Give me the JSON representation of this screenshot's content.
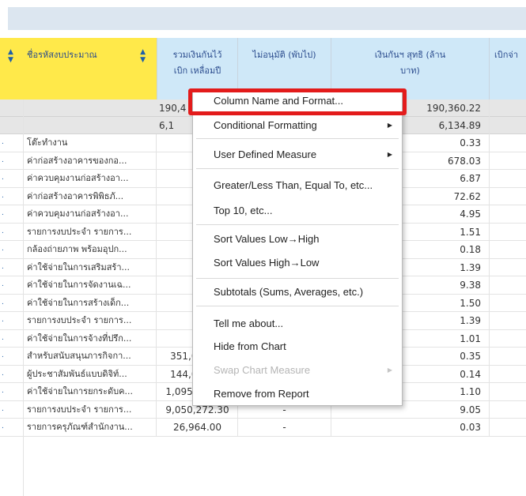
{
  "header": {
    "col_name": "ชื่อรหัสงบประมาณ",
    "col_a": "รวมเงินกันไว้เบิก เหลื่อมปี",
    "col_b": "ไม่อนุมัติ (พับไป)",
    "col_c": "เงินกันฯ สุทธิ (ล้าน บาท)",
    "col_d": "เบิกจ่า"
  },
  "totals": [
    {
      "a": "190,4",
      "c": "190,360.22"
    },
    {
      "a": "6,1",
      "c": "6,134.89"
    }
  ],
  "rows": [
    {
      "name": "โต๊ะทำงาน",
      "a": "",
      "b": "",
      "c": "0.33"
    },
    {
      "name": "ค่าก่อสร้างอาคารของกอ...",
      "a": "6",
      "b": "",
      "c": "678.03"
    },
    {
      "name": "ค่าควบคุมงานก่อสร้างอา...",
      "a": "",
      "b": "",
      "c": "6.87"
    },
    {
      "name": "ค่าก่อสร้างอาคารพิพิธภั...",
      "a": "",
      "b": "",
      "c": "72.62"
    },
    {
      "name": "ค่าควบคุมงานก่อสร้างอา...",
      "a": "",
      "b": "",
      "c": "4.95"
    },
    {
      "name": "รายการงบประจำ รายการ...",
      "a": "",
      "b": "",
      "c": "1.51"
    },
    {
      "name": "กล้องถ่ายภาพ พร้อมอุปก...",
      "a": "",
      "b": "",
      "c": "0.18"
    },
    {
      "name": "ค่าใช้จ่ายในการเสริมสร้า...",
      "a": "",
      "b": "",
      "c": "1.39"
    },
    {
      "name": "ค่าใช้จ่ายในการจัดงานเฉ...",
      "a": "",
      "b": "",
      "c": "9.38"
    },
    {
      "name": "ค่าใช้จ่ายในการสร้างเด็ก...",
      "a": "",
      "b": "",
      "c": "1.50"
    },
    {
      "name": "รายการงบประจำ รายการ...",
      "a": "",
      "b": "",
      "c": "1.39"
    },
    {
      "name": "ค่าใช้จ่ายในการจ้างที่ปรึก...",
      "a": "",
      "b": "",
      "c": "1.01"
    },
    {
      "name": "สำหรับสนับสนุนภารกิจกา...",
      "a": "351,002.00",
      "b": "",
      "c": "0.35"
    },
    {
      "name": "ผู้ประชาสัมพันธ์แบบดิจิท์...",
      "a": "144,000.00",
      "b": "-",
      "c": "0.14"
    },
    {
      "name": "ค่าใช้จ่ายในการยกระดับค...",
      "a": "1,095,000.00",
      "b": "-",
      "c": "1.10"
    },
    {
      "name": "รายการงบประจำ รายการ...",
      "a": "9,050,272.30",
      "b": "-",
      "c": "9.05"
    },
    {
      "name": "รายการครุภัณฑ์สำนักงาน...",
      "a": "26,964.00",
      "b": "-",
      "c": "0.03"
    }
  ],
  "context_menu": {
    "items": [
      {
        "label": "Column Name and Format...",
        "submenu": false,
        "disabled": false
      },
      {
        "label": "Conditional Formatting",
        "submenu": true,
        "disabled": false
      },
      {
        "label": "User Defined Measure",
        "submenu": true,
        "disabled": false
      },
      {
        "label": "Greater/Less Than, Equal To, etc...",
        "submenu": false,
        "disabled": false
      },
      {
        "label": "Top 10, etc...",
        "submenu": false,
        "disabled": false
      },
      {
        "label": "Sort Values Low→High",
        "submenu": false,
        "disabled": false
      },
      {
        "label": "Sort Values High→Low",
        "submenu": false,
        "disabled": false
      },
      {
        "label": "Subtotals (Sums, Averages, etc.)",
        "submenu": false,
        "disabled": false
      },
      {
        "label": "Tell me about...",
        "submenu": false,
        "disabled": false
      },
      {
        "label": "Hide from Chart",
        "submenu": false,
        "disabled": false
      },
      {
        "label": "Swap Chart Measure",
        "submenu": true,
        "disabled": true
      },
      {
        "label": "Remove from Report",
        "submenu": false,
        "disabled": false
      }
    ],
    "highlighted_item": "Column Name and Format..."
  },
  "colors": {
    "header_yellow": "#ffe94a",
    "header_blue": "#cfe8f8",
    "highlight_red": "#e31b1b",
    "total_row_gray": "#e6e6e6"
  }
}
